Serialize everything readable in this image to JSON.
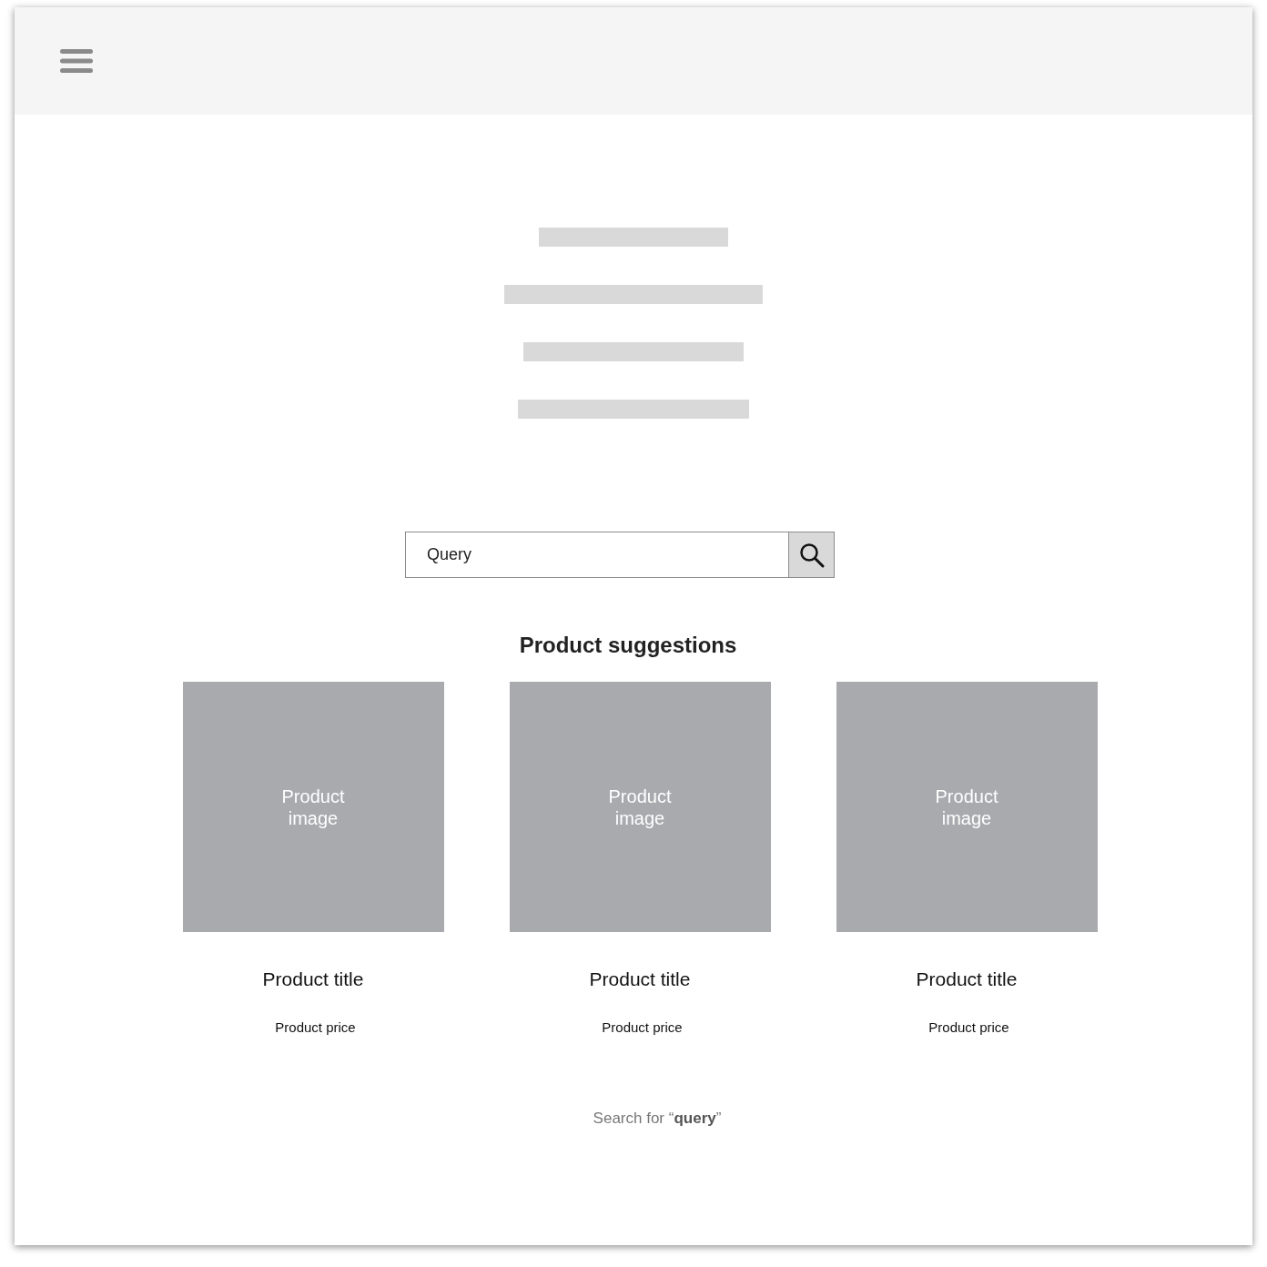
{
  "search": {
    "placeholder": "Query"
  },
  "suggestions": {
    "title": "Product suggestions",
    "products": [
      {
        "image": {
          "kind": "picture",
          "label": "Product image"
        },
        "title": "Product title",
        "price": "Product price"
      },
      {
        "image": {
          "kind": "picture",
          "label": "Product image"
        },
        "title": "Product title",
        "price": "Product price"
      },
      {
        "image": {
          "kind": "picture",
          "label": "Product image"
        },
        "title": "Product title",
        "price": "Product price"
      }
    ]
  },
  "search_link": "Search for “**query**”"
}
